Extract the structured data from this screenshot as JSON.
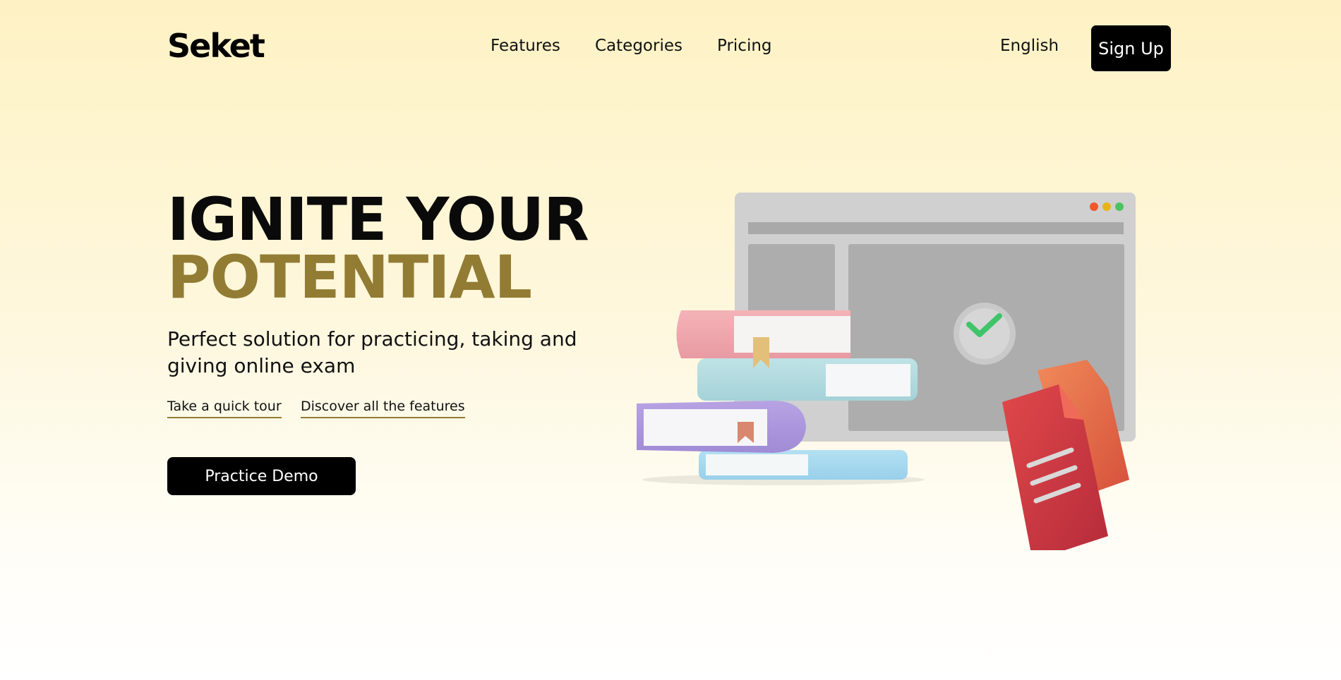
{
  "nav": {
    "logo": "Seket",
    "links": [
      "Features",
      "Categories",
      "Pricing"
    ],
    "language": "English",
    "signup": "Sign Up"
  },
  "hero": {
    "title_line1": "IGNITE YOUR",
    "title_line2": "POTENTIAL",
    "subtitle": "Perfect solution for practicing, taking and giving online exam",
    "link_tour": "Take a quick tour",
    "link_features": "Discover all the features",
    "cta": "Practice Demo"
  },
  "colors": {
    "accent": "#927c34",
    "primary_button": "#000000",
    "background_top": "#fef2c4"
  }
}
